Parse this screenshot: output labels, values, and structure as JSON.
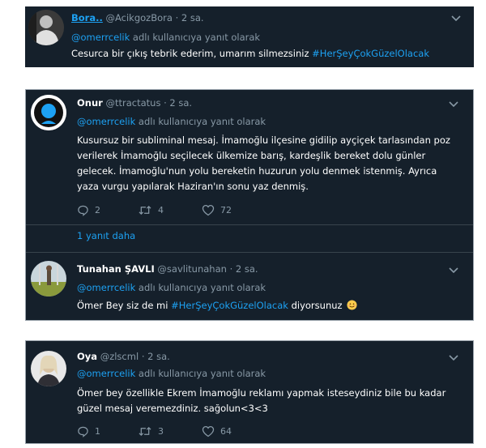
{
  "tweets": [
    {
      "name": "Bora..",
      "handle": "@AcikgozBora",
      "time": "· 2 sa.",
      "reply_prefix": "@omerrcelik",
      "reply_suffix": " adlı kullanıcıya yanıt olarak",
      "text": "Cesurca bir çıkış tebrik ederim, umarım silmezsiniz ",
      "hashtag": "#HerŞeyÇokGüzelOlacak"
    },
    {
      "name": "Onur",
      "handle": "@ttractatus",
      "time": "· 2 sa.",
      "reply_prefix": "@omerrcelik",
      "reply_suffix": " adlı kullanıcıya yanıt olarak",
      "lines": [
        "Kusursuz bir subliminal mesaj. İmamoğlu ilçesine gidilip ayçiçek tarlasından poz",
        "verilerek İmamoğlu seçilecek ülkemize barış, kardeşlik bereket dolu günler",
        "gelecek. İmamoğlu'nun yolu bereketin huzurun yolu denmek istenmiş. Ayrıca",
        "yaza vurgu yapılarak Haziran'ın sonu yaz denmiş."
      ],
      "replies": "2",
      "retweets": "4",
      "likes": "72",
      "more_replies": "1 yanıt daha"
    },
    {
      "name": "Tunahan ŞAVLI",
      "handle": "@savlitunahan",
      "time": "· 2 sa.",
      "reply_prefix": "@omerrcelik",
      "reply_suffix": " adlı kullanıcıya yanıt olarak",
      "text_before": "Ömer Bey siz de mi ",
      "hashtag": "#HerŞeyÇokGüzelOlacak",
      "text_after": " diyorsunuz "
    },
    {
      "name": "Oya",
      "handle": "@zlscml",
      "time": "· 2 sa.",
      "reply_prefix": "@omerrcelik",
      "reply_suffix": " adlı kullanıcıya yanıt olarak",
      "lines": [
        "Ömer bey özellikle Ekrem İmamoğlu reklamı yapmak isteseydiniz bile bu kadar",
        "güzel mesaj veremezdiniz. sağolun<3<3"
      ],
      "replies": "1",
      "retweets": "3",
      "likes": "64"
    }
  ],
  "colors": {
    "background": "#15202b",
    "accent": "#1da1f2",
    "muted": "#8899a6",
    "text": "#ffffff"
  },
  "icons": [
    "chevron-down-icon",
    "reply-icon",
    "retweet-icon",
    "like-icon",
    "smiling-face-emoji"
  ]
}
